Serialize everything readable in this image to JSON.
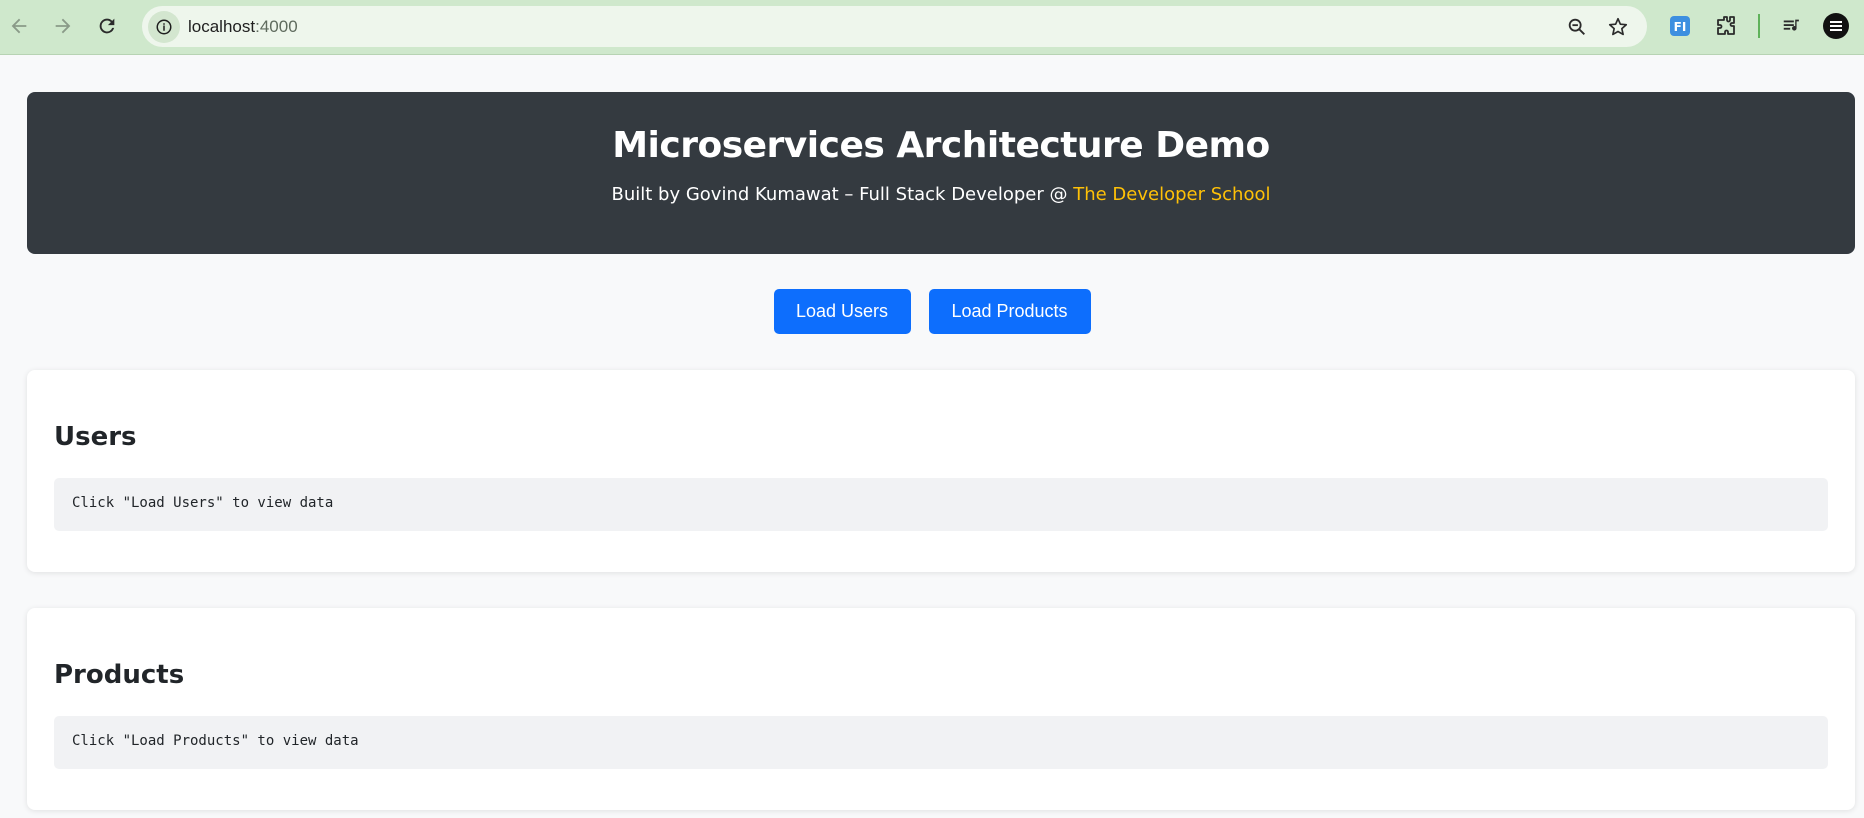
{
  "browser": {
    "url_host": "localhost",
    "url_port": ":4000"
  },
  "header": {
    "title": "Microservices Architecture Demo",
    "subtitle_prefix": "Built by Govind Kumawat – Full Stack Developer @ ",
    "subtitle_link": "The Developer School"
  },
  "actions": {
    "load_users_label": "Load Users",
    "load_products_label": "Load Products"
  },
  "users_section": {
    "title": "Users",
    "placeholder": "Click \"Load Users\" to view data"
  },
  "products_section": {
    "title": "Products",
    "placeholder": "Click \"Load Products\" to view data"
  },
  "colors": {
    "primary": "#0d6efd",
    "header_bg": "#343a40",
    "link_accent": "#ffc107",
    "chrome_bg": "#cfe8cc"
  }
}
